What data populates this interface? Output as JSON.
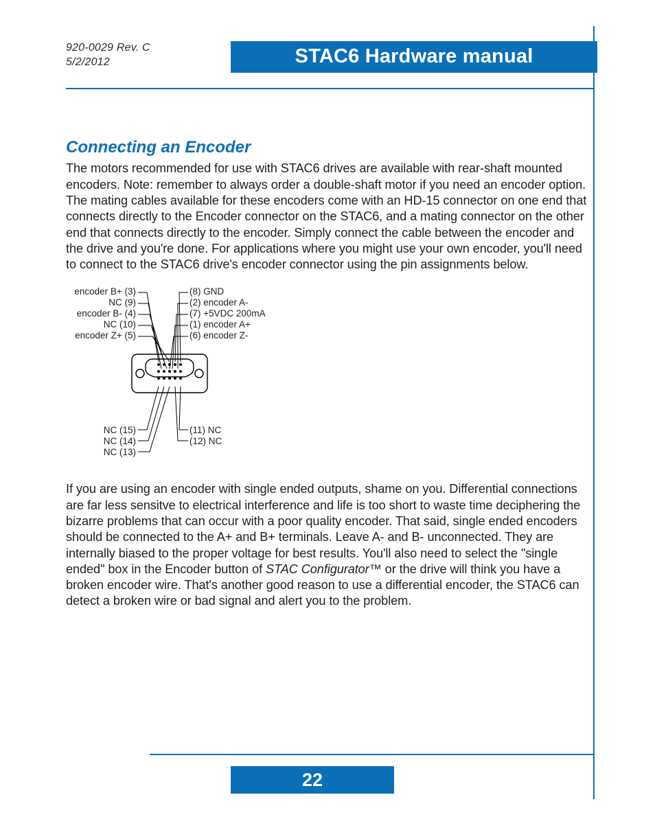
{
  "meta": {
    "rev": "920-0029 Rev. C",
    "date": "5/2/2012"
  },
  "title": "STAC6 Hardware manual",
  "section_heading": "Connecting an Encoder",
  "para1": "The motors recommended for use with STAC6 drives are available with rear-shaft mounted encoders.  Note: remember to always order a double-shaft motor if you need an encoder option.  The mating cables available for these encoders come with an HD-15 connector on one end that connects directly to the Encoder connector on the STAC6, and a mating connector on the other end that connects directly to the encoder.  Simply connect the cable between the encoder and the drive and you're done.  For applications where you might use your own encoder, you'll need to connect to the STAC6 drive's encoder connector using the pin assignments below.",
  "pin_labels": {
    "left": [
      "encoder B+ (3)",
      "NC  (9)",
      "encoder B- (4)",
      "NC (10)",
      "encoder Z+ (5)"
    ],
    "right": [
      "(8) GND",
      "(2) encoder A-",
      "(7) +5VDC 200mA",
      "(1) encoder A+",
      "(6) encoder Z-"
    ],
    "bottom_left": [
      "NC (15)",
      "NC (14)",
      "NC (13)"
    ],
    "bottom_right": [
      "(11) NC",
      "(12) NC"
    ]
  },
  "para2_a": "If you are using an encoder with single ended outputs, shame on you. Differential connections are far less sensitve to electrical interference and life is too short to waste time deciphering the bizarre problems that can occur with a poor quality encoder. That said, single ended encoders should be connected to the A+ and B+ terminals. Leave A- and B- unconnected. They are internally biased to the proper voltage for best results. You'll also need to select the \"single ended\" box in the Encoder button of ",
  "para2_em": "STAC Configurator™",
  "para2_b": " or the drive will think you have a broken encoder wire. That's another good reason to use a differential encoder, the STAC6 can detect a broken wire or bad signal and alert you to the problem.",
  "page_number": "22"
}
